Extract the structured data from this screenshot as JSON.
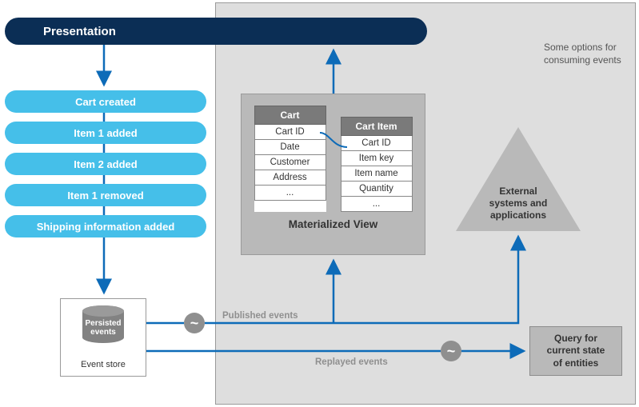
{
  "presentation": {
    "label": "Presentation"
  },
  "events": [
    {
      "label": "Cart created"
    },
    {
      "label": "Item 1 added"
    },
    {
      "label": "Item 2 added"
    },
    {
      "label": "Item 1 removed"
    },
    {
      "label": "Shipping information added"
    }
  ],
  "note": {
    "line1": "Some options for",
    "line2": "consuming events"
  },
  "materialized_view": {
    "title": "Materialized View",
    "table_cart": {
      "header": "Cart",
      "rows": [
        "Cart ID",
        "Date",
        "Customer",
        "Address",
        "..."
      ]
    },
    "table_cart_item": {
      "header": "Cart Item",
      "rows": [
        "Cart ID",
        "Item key",
        "Item name",
        "Quantity",
        "..."
      ]
    }
  },
  "event_store": {
    "cylinder_label_l1": "Persisted",
    "cylinder_label_l2": "events",
    "box_label": "Event store"
  },
  "external": {
    "line1": "External",
    "line2": "systems and",
    "line3": "applications"
  },
  "query_box": {
    "line1": "Query for",
    "line2": "current state",
    "line3": "of entities"
  },
  "flows": {
    "published": "Published events",
    "replayed": "Replayed events"
  },
  "colors": {
    "pill_blue": "#45bfe9",
    "dark_blue": "#0b2e55",
    "arrow_blue": "#0d6bb8",
    "panel_gray": "#dedede",
    "mid_gray": "#b9b9b9"
  }
}
